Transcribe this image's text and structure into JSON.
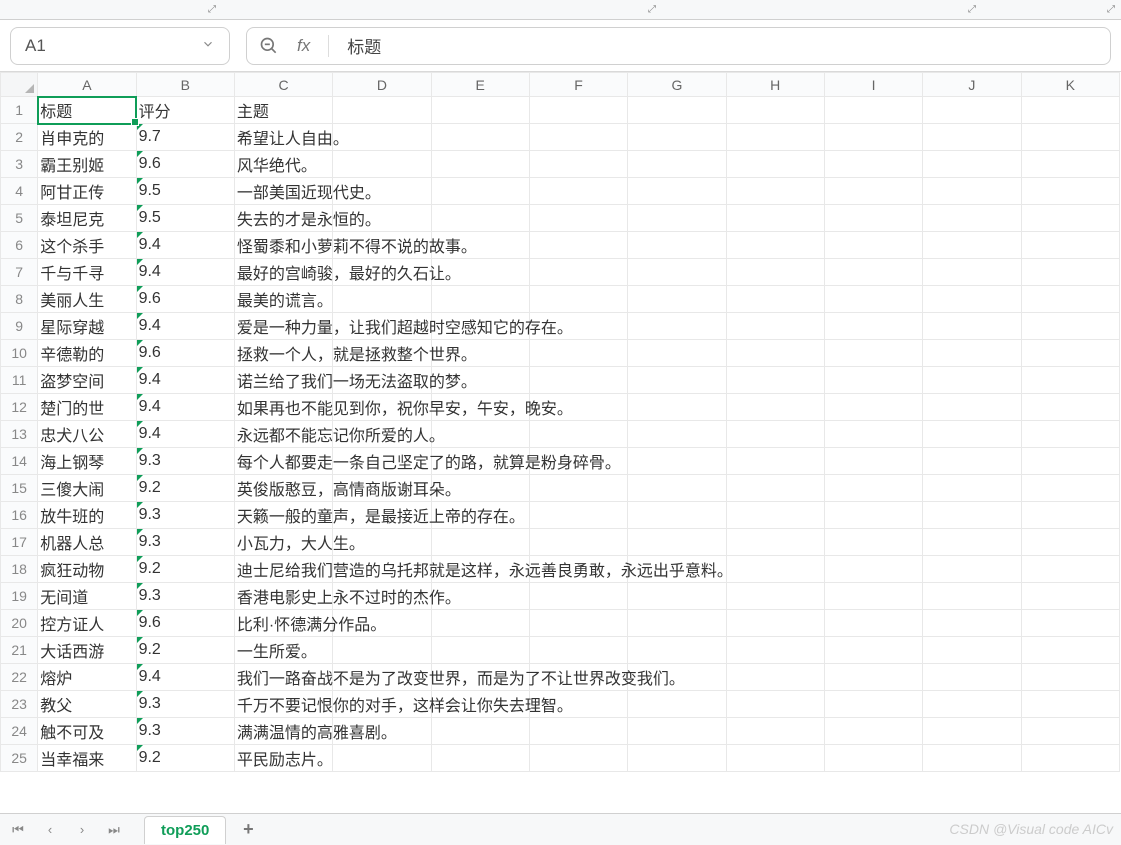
{
  "namebox": {
    "cell_ref": "A1"
  },
  "formulabar": {
    "fx_label": "fx",
    "content": "标题"
  },
  "columns": [
    "A",
    "B",
    "C",
    "D",
    "E",
    "F",
    "G",
    "H",
    "I",
    "J",
    "K"
  ],
  "sheet": {
    "active_tab": "top250",
    "rows": [
      {
        "num": 1,
        "a": "标题",
        "b": "评分",
        "c": "主题",
        "a_marked": false,
        "b_marked": false
      },
      {
        "num": 2,
        "a": "肖申克的",
        "b": "9.7",
        "c": "希望让人自由。"
      },
      {
        "num": 3,
        "a": "霸王别姬",
        "b": "9.6",
        "c": "风华绝代。"
      },
      {
        "num": 4,
        "a": "阿甘正传",
        "b": "9.5",
        "c": "一部美国近现代史。"
      },
      {
        "num": 5,
        "a": "泰坦尼克",
        "b": "9.5",
        "c": "失去的才是永恒的。"
      },
      {
        "num": 6,
        "a": "这个杀手",
        "b": "9.4",
        "c": "怪蜀黍和小萝莉不得不说的故事。"
      },
      {
        "num": 7,
        "a": "千与千寻",
        "b": "9.4",
        "c": "最好的宫崎骏，最好的久石让。"
      },
      {
        "num": 8,
        "a": "美丽人生",
        "b": "9.6",
        "c": "最美的谎言。"
      },
      {
        "num": 9,
        "a": "星际穿越",
        "b": "9.4",
        "c": "爱是一种力量，让我们超越时空感知它的存在。"
      },
      {
        "num": 10,
        "a": "辛德勒的",
        "b": "9.6",
        "c": "拯救一个人，就是拯救整个世界。"
      },
      {
        "num": 11,
        "a": "盗梦空间",
        "b": "9.4",
        "c": "诺兰给了我们一场无法盗取的梦。"
      },
      {
        "num": 12,
        "a": "楚门的世",
        "b": "9.4",
        "c": "如果再也不能见到你，祝你早安，午安，晚安。"
      },
      {
        "num": 13,
        "a": "忠犬八公",
        "b": "9.4",
        "c": "永远都不能忘记你所爱的人。"
      },
      {
        "num": 14,
        "a": "海上钢琴",
        "b": "9.3",
        "c": "每个人都要走一条自己坚定了的路，就算是粉身碎骨。"
      },
      {
        "num": 15,
        "a": "三傻大闹",
        "b": "9.2",
        "c": "英俊版憨豆，高情商版谢耳朵。"
      },
      {
        "num": 16,
        "a": "放牛班的",
        "b": "9.3",
        "c": "天籁一般的童声，是最接近上帝的存在。"
      },
      {
        "num": 17,
        "a": "机器人总",
        "b": "9.3",
        "c": "小瓦力，大人生。"
      },
      {
        "num": 18,
        "a": "疯狂动物",
        "b": "9.2",
        "c": "迪士尼给我们营造的乌托邦就是这样，永远善良勇敢，永远出乎意料。"
      },
      {
        "num": 19,
        "a": "无间道",
        "b": "9.3",
        "c": "香港电影史上永不过时的杰作。"
      },
      {
        "num": 20,
        "a": "控方证人",
        "b": "9.6",
        "c": "比利·怀德满分作品。"
      },
      {
        "num": 21,
        "a": "大话西游",
        "b": "9.2",
        "c": "一生所爱。"
      },
      {
        "num": 22,
        "a": "熔炉",
        "b": "9.4",
        "c": "我们一路奋战不是为了改变世界，而是为了不让世界改变我们。"
      },
      {
        "num": 23,
        "a": "教父",
        "b": "9.3",
        "c": "千万不要记恨你的对手，这样会让你失去理智。"
      },
      {
        "num": 24,
        "a": "触不可及",
        "b": "9.3",
        "c": "满满温情的高雅喜剧。"
      },
      {
        "num": 25,
        "a": "当幸福来",
        "b": "9.2",
        "c": "平民励志片。"
      }
    ]
  },
  "watermark": "CSDN @Visual code AICv"
}
